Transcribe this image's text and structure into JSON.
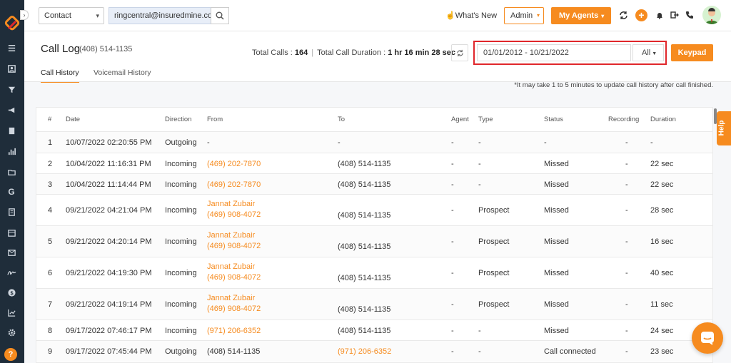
{
  "colors": {
    "accent": "#f68b1f",
    "sidebar": "#1f2d3a",
    "highlight": "#e0262b"
  },
  "topbar": {
    "contact_select": "Contact",
    "search_value": "ringcentral@insuredmine.com",
    "whats_new": "What's New",
    "admin_select": "Admin",
    "agents_button": "My Agents",
    "plus_label": "+"
  },
  "header": {
    "title": "Call Log",
    "phone": "(408) 514-1135",
    "total_calls_label": "Total Calls :",
    "total_calls_value": "164",
    "total_duration_label": "Total Call Duration :",
    "total_duration_value": "1 hr 16 min 28 sec",
    "date_range": "01/01/2012 - 10/21/2022",
    "filter_select": "All",
    "keypad_button": "Keypad"
  },
  "tabs": [
    {
      "label": "Call History",
      "active": true
    },
    {
      "label": "Voicemail History",
      "active": false
    }
  ],
  "note": "*It may take 1 to 5 minutes to update call history after call finished.",
  "table": {
    "columns": [
      "#",
      "Date",
      "Direction",
      "From",
      "To",
      "Agent",
      "Type",
      "Status",
      "Recording",
      "Duration"
    ],
    "rows": [
      {
        "num": "1",
        "date": "10/07/2022 02:20:55 PM",
        "direction": "Outgoing",
        "from_name": "",
        "from_phone": "-",
        "to_phone": "-",
        "to_link": false,
        "agent": "-",
        "type": "-",
        "status": "-",
        "recording": "-",
        "duration": "-"
      },
      {
        "num": "2",
        "date": "10/04/2022 11:16:31 PM",
        "direction": "Incoming",
        "from_name": "",
        "from_phone": "(469) 202-7870",
        "to_phone": "(408) 514-1135",
        "to_link": false,
        "agent": "-",
        "type": "-",
        "status": "Missed",
        "recording": "-",
        "duration": "22 sec"
      },
      {
        "num": "3",
        "date": "10/04/2022 11:14:44 PM",
        "direction": "Incoming",
        "from_name": "",
        "from_phone": "(469) 202-7870",
        "to_phone": "(408) 514-1135",
        "to_link": false,
        "agent": "-",
        "type": "-",
        "status": "Missed",
        "recording": "-",
        "duration": "22 sec"
      },
      {
        "num": "4",
        "date": "09/21/2022 04:21:04 PM",
        "direction": "Incoming",
        "from_name": "Jannat Zubair",
        "from_phone": "(469) 908-4072",
        "to_phone": "(408) 514-1135",
        "to_link": false,
        "agent": "-",
        "type": "Prospect",
        "status": "Missed",
        "recording": "-",
        "duration": "28 sec"
      },
      {
        "num": "5",
        "date": "09/21/2022 04:20:14 PM",
        "direction": "Incoming",
        "from_name": "Jannat Zubair",
        "from_phone": "(469) 908-4072",
        "to_phone": "(408) 514-1135",
        "to_link": false,
        "agent": "-",
        "type": "Prospect",
        "status": "Missed",
        "recording": "-",
        "duration": "16 sec"
      },
      {
        "num": "6",
        "date": "09/21/2022 04:19:30 PM",
        "direction": "Incoming",
        "from_name": "Jannat Zubair",
        "from_phone": "(469) 908-4072",
        "to_phone": "(408) 514-1135",
        "to_link": false,
        "agent": "-",
        "type": "Prospect",
        "status": "Missed",
        "recording": "-",
        "duration": "40 sec"
      },
      {
        "num": "7",
        "date": "09/21/2022 04:19:14 PM",
        "direction": "Incoming",
        "from_name": "Jannat Zubair",
        "from_phone": "(469) 908-4072",
        "to_phone": "(408) 514-1135",
        "to_link": false,
        "agent": "-",
        "type": "Prospect",
        "status": "Missed",
        "recording": "-",
        "duration": "11 sec"
      },
      {
        "num": "8",
        "date": "09/17/2022 07:46:17 PM",
        "direction": "Incoming",
        "from_name": "",
        "from_phone": "(971) 206-6352",
        "to_phone": "(408) 514-1135",
        "to_link": false,
        "agent": "-",
        "type": "-",
        "status": "Missed",
        "recording": "-",
        "duration": "24 sec"
      },
      {
        "num": "9",
        "date": "09/17/2022 07:45:44 PM",
        "direction": "Outgoing",
        "from_name": "",
        "from_phone": "(408) 514-1135",
        "to_phone": "(971) 206-6352",
        "to_link": true,
        "agent": "-",
        "type": "-",
        "status": "Call connected",
        "recording": "-",
        "duration": "23 sec"
      }
    ]
  },
  "help_tab": "Help",
  "sidebar_help": "?",
  "icons": [
    "logo-icon",
    "menu-icon",
    "contacts-icon",
    "filter-icon",
    "megaphone-icon",
    "document-icon",
    "analytics-icon",
    "folder-icon",
    "google-icon",
    "form-icon",
    "calendar-icon",
    "mail-icon",
    "signature-icon",
    "dollar-icon",
    "chart-icon",
    "gear-icon",
    "help-icon"
  ]
}
